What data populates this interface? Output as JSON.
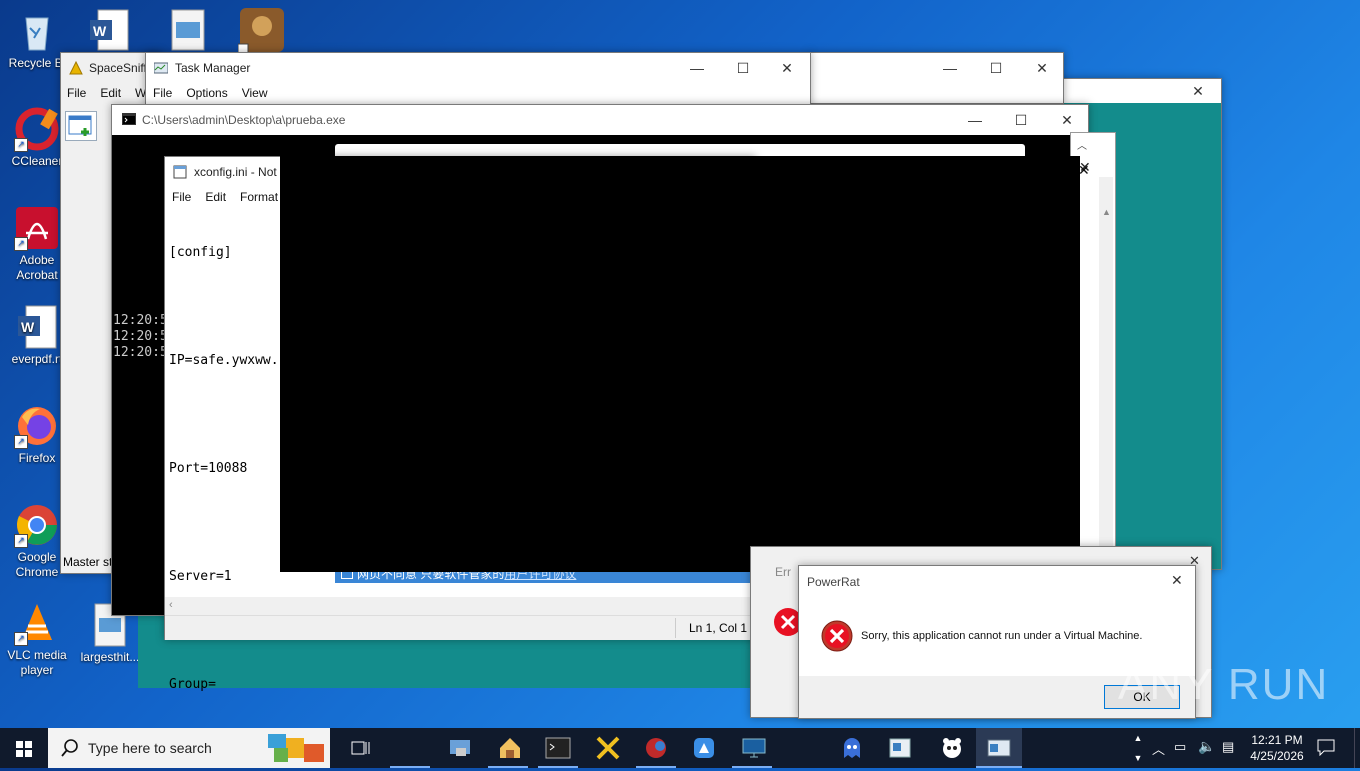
{
  "desktop": {
    "icons": [
      {
        "label": "Recycle Bin",
        "name": "recycle-bin"
      },
      {
        "label": "CCleaner",
        "name": "ccleaner"
      },
      {
        "label": "Adobe Acrobat",
        "name": "adobe-acrobat"
      },
      {
        "label": "everpdf.rtf",
        "name": "everpdf"
      },
      {
        "label": "Firefox",
        "name": "firefox"
      },
      {
        "label": "Google Chrome",
        "name": "google-chrome"
      },
      {
        "label": "VLC media player",
        "name": "vlc"
      },
      {
        "label": "largesthit...",
        "name": "largesthit"
      }
    ],
    "icon_labels": {
      "recycle": "Recycle Bi",
      "ccleaner": "CCleaner",
      "acrobat1": "Adobe",
      "acrobat2": "Acrobat",
      "everpdf": "everpdf.rt",
      "firefox": "Firefox",
      "chrome1": "Google",
      "chrome2": "Chrome",
      "vlc1": "VLC media",
      "vlc2": "player",
      "largesthit": "largesthit..."
    }
  },
  "spacesniffer": {
    "title": "SpaceSniff",
    "menu": [
      "File",
      "Edit",
      "W"
    ],
    "status": "Master st"
  },
  "taskmanager": {
    "title": "Task Manager",
    "menu": [
      "File",
      "Options",
      "View"
    ]
  },
  "console": {
    "title": "C:\\Users\\admin\\Desktop\\a\\prueba.exe",
    "lines": [
      "12:20:5",
      "12:20:5",
      "12:20:5"
    ]
  },
  "notepad": {
    "title": "xconfig.ini - Not",
    "menu": [
      "File",
      "Edit",
      "Format"
    ],
    "lines": [
      "[config]",
      "",
      "IP=safe.ywxww.",
      "",
      "Port=10088",
      "",
      "Server=1",
      "",
      "Group="
    ],
    "status": "Ln 1, Col 1"
  },
  "behind_window": {
    "text_garbled": "网页不同意 只要软件管家的",
    "link": "用户许可协议"
  },
  "second_error": {
    "title_partial": "Err"
  },
  "dialog": {
    "title": "PowerRat",
    "message": "Sorry, this application cannot run under a Virtual Machine.",
    "ok": "OK"
  },
  "watermark": "ANY RUN",
  "taskbar": {
    "search_placeholder": "Type here to search",
    "time": "12:21 PM",
    "date": "4/25/2026"
  },
  "colors": {
    "teal": "#138c8c",
    "error_red": "#e81123",
    "selection_blue": "#3a86d6"
  }
}
